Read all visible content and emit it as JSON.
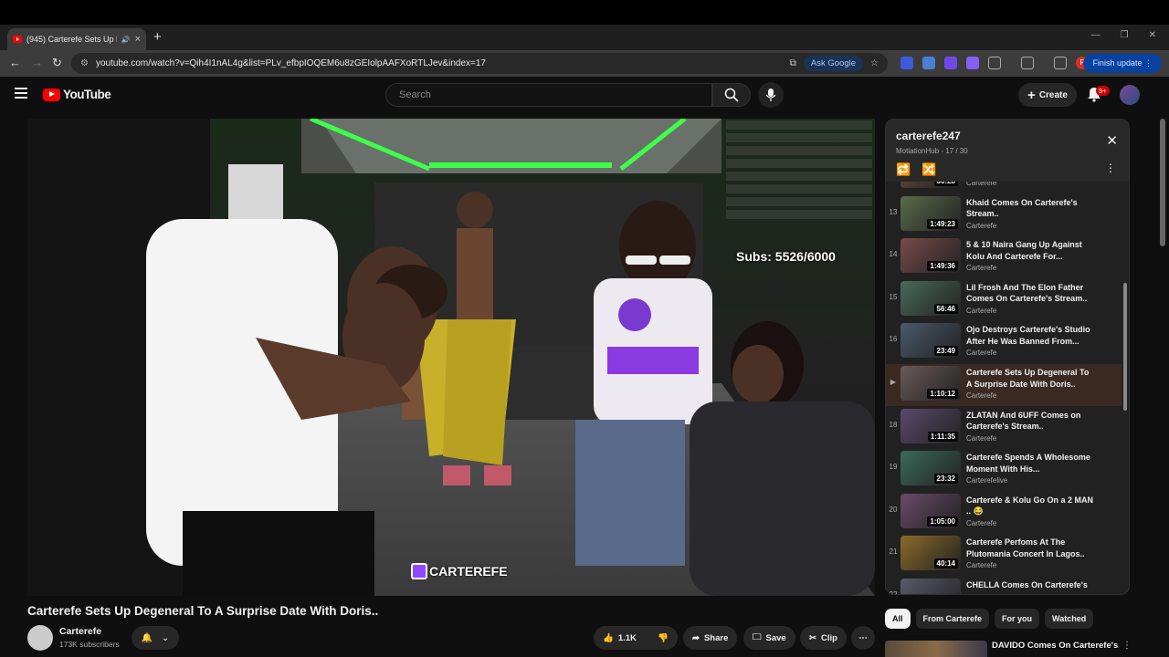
{
  "browser": {
    "tab_title": "(945) Carterefe Sets Up De",
    "url": "youtube.com/watch?v=Qih4I1nAL4g&list=PLv_efbpIOQEM6u8zGEIolpAAFXoRTLJev&index=17",
    "ask_google": "Ask Google",
    "finish_update": "Finish update",
    "profile_letter": "P"
  },
  "youtube": {
    "logo_text": "YouTube",
    "search_placeholder": "Search",
    "create_label": "Create",
    "notif_badge": "9+"
  },
  "video": {
    "subs_overlay": "Subs: 5526/6000",
    "watermark": "CARTEREFE",
    "title": "Carterefe Sets Up Degeneral To A Surprise Date With Doris..",
    "channel": "Carterefe",
    "subscribers": "173K subscribers",
    "likes": "1.1K",
    "share_label": "Share",
    "save_label": "Save",
    "clip_label": "Clip"
  },
  "playlist": {
    "title": "carterefe247",
    "subtitle": "MotiationHub - 17 / 30",
    "items": [
      {
        "index": "",
        "title": "",
        "channel": "Carterefe",
        "duration": "50:28",
        "thumb": "#6a4a3a"
      },
      {
        "index": "13",
        "title": "Khaid Comes On Carterefe's Stream..",
        "channel": "Carterefe",
        "duration": "1:49:23",
        "thumb": "#5a6a4a"
      },
      {
        "index": "14",
        "title": "5 & 10 Naira Gang Up Against Kolu And Carterefe For...",
        "channel": "Carterefe",
        "duration": "1:49:36",
        "thumb": "#7a4a4a"
      },
      {
        "index": "15",
        "title": "Lil Frosh And The Elon Father Comes On Carterefe's Stream..",
        "channel": "Carterefe",
        "duration": "56:46",
        "thumb": "#4a6a5a"
      },
      {
        "index": "16",
        "title": "Ojo Destroys Carterefe's Studio After He Was Banned From...",
        "channel": "Carterefe",
        "duration": "23:49",
        "thumb": "#4a5a6a"
      },
      {
        "index": "▶",
        "title": "Carterefe Sets Up Degeneral To A Surprise Date With Doris..",
        "channel": "Carterefe",
        "duration": "1:10:12",
        "thumb": "#6a5a5a",
        "active": true
      },
      {
        "index": "18",
        "title": "ZLATAN And 6UFF Comes on Carterefe's Stream..",
        "channel": "Carterefe",
        "duration": "1:11:35",
        "thumb": "#5a4a6a"
      },
      {
        "index": "19",
        "title": "Carterefe Spends A Wholesome Moment With His...",
        "channel": "Carterefelive",
        "duration": "23:32",
        "thumb": "#3a6a5a"
      },
      {
        "index": "20",
        "title": "Carterefe & Kolu Go On a 2 MAN .. 😂",
        "channel": "Carterefe",
        "duration": "1:05:00",
        "thumb": "#6a4a6a"
      },
      {
        "index": "21",
        "title": "Carterefe Perfoms At The Plutomania Concert In Lagos..",
        "channel": "Carterefe",
        "duration": "40:14",
        "thumb": "#8a6a2a"
      },
      {
        "index": "22",
        "title": "CHELLA Comes On Carterefe's",
        "channel": "",
        "duration": "",
        "thumb": "#5a5a6a"
      }
    ]
  },
  "chips": [
    "All",
    "From Carterefe",
    "For you",
    "Watched"
  ],
  "next_video_title": "DAVIDO Comes On Carterefe's"
}
